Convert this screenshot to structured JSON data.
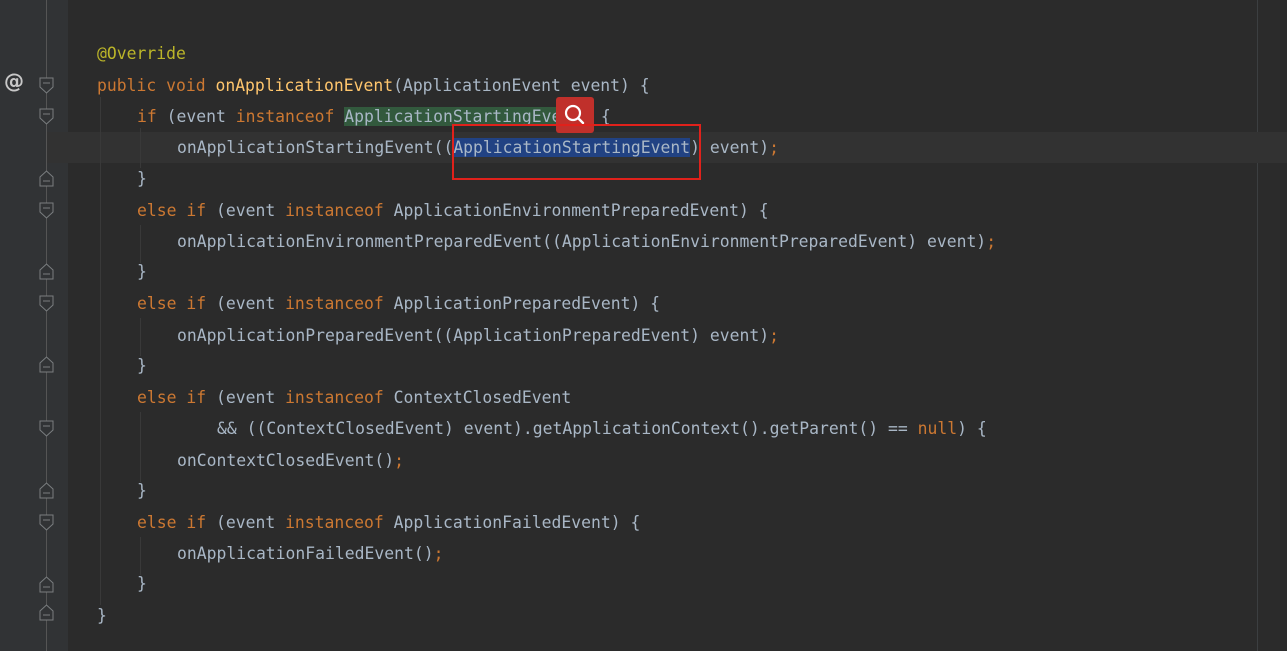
{
  "gutter": {
    "override_marker": "@"
  },
  "code": {
    "l1": {
      "annotation": "@Override"
    },
    "l2": {
      "kw_public": "public",
      "kw_void": "void",
      "method": "onApplicationEvent",
      "params": "(ApplicationEvent event) {"
    },
    "l3": {
      "kw_if": "if",
      "open": " (event ",
      "kw_instanceof": "instanceof",
      "class": "ApplicationStartingEvent",
      "close": ") {"
    },
    "l4": {
      "call": "onApplicationStartingEvent(",
      "cast_open": "(",
      "cast_type": "ApplicationStartingEvent",
      "cast_close": ") event)",
      "semi": ";"
    },
    "l5": {
      "brace": "}"
    },
    "l6": {
      "kw_else": "else",
      "kw_if": "if",
      "open": " (event ",
      "kw_instanceof": "instanceof",
      "rest": " ApplicationEnvironmentPreparedEvent) {"
    },
    "l7": {
      "text": "onApplicationEnvironmentPreparedEvent((ApplicationEnvironmentPreparedEvent) event)",
      "semi": ";"
    },
    "l8": {
      "brace": "}"
    },
    "l9": {
      "kw_else": "else",
      "kw_if": "if",
      "open": " (event ",
      "kw_instanceof": "instanceof",
      "rest": " ApplicationPreparedEvent) {"
    },
    "l10": {
      "text": "onApplicationPreparedEvent((ApplicationPreparedEvent) event)",
      "semi": ";"
    },
    "l11": {
      "brace": "}"
    },
    "l12": {
      "kw_else": "else",
      "kw_if": "if",
      "open": " (event ",
      "kw_instanceof": "instanceof",
      "rest": " ContextClosedEvent"
    },
    "l13": {
      "text": "&& ((ContextClosedEvent) event).getApplicationContext().getParent() == ",
      "kw_null": "null",
      "close": ") {"
    },
    "l14": {
      "text": "onContextClosedEvent()",
      "semi": ";"
    },
    "l15": {
      "brace": "}"
    },
    "l16": {
      "kw_else": "else",
      "kw_if": "if",
      "open": " (event ",
      "kw_instanceof": "instanceof",
      "rest": " ApplicationFailedEvent) {"
    },
    "l17": {
      "text": "onApplicationFailedEvent()",
      "semi": ";"
    },
    "l18": {
      "brace": "}"
    },
    "l19": {
      "brace": "}"
    }
  },
  "colors": {
    "background": "#2b2b2b",
    "gutter": "#313335",
    "keyword": "#cc7832",
    "annotation": "#bbb529",
    "method_declaration": "#ffc66d",
    "identifier": "#a9b7c6",
    "selection": "#214283",
    "match_highlight": "#32593d",
    "callout_border": "#e0211b",
    "intention_bulb": "#c0302b"
  },
  "icons": {
    "override": "override-at-icon",
    "fold": "fold-marker-icon",
    "intention": "magnifier-intention-icon"
  }
}
